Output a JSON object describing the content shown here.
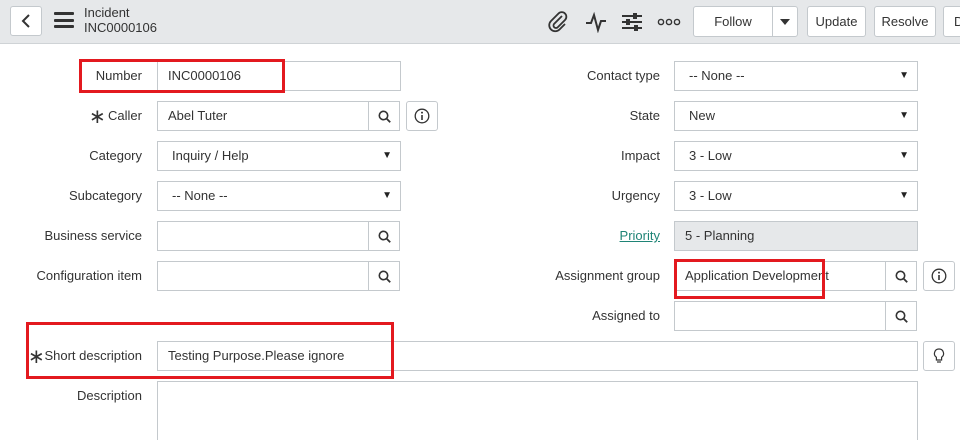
{
  "header": {
    "record_type": "Incident",
    "record_number": "INC0000106",
    "icons": [
      "back-icon",
      "menu-icon",
      "paperclip-icon",
      "activity-icon",
      "sliders-icon",
      "more-icon"
    ],
    "buttons": {
      "follow": "Follow",
      "update": "Update",
      "resolve": "Resolve",
      "delete_partial": "D"
    }
  },
  "form": {
    "number": {
      "label": "Number",
      "value": "INC0000106"
    },
    "caller": {
      "label": "Caller",
      "value": "Abel Tuter",
      "required": true
    },
    "category": {
      "label": "Category",
      "value": "Inquiry / Help"
    },
    "subcategory": {
      "label": "Subcategory",
      "value": "-- None --"
    },
    "business_service": {
      "label": "Business service",
      "value": ""
    },
    "configuration_item": {
      "label": "Configuration item",
      "value": ""
    },
    "contact_type": {
      "label": "Contact type",
      "value": "-- None --"
    },
    "state": {
      "label": "State",
      "value": "New"
    },
    "impact": {
      "label": "Impact",
      "value": "3 - Low"
    },
    "urgency": {
      "label": "Urgency",
      "value": "3 - Low"
    },
    "priority": {
      "label": "Priority",
      "value": "5 - Planning"
    },
    "assignment_group": {
      "label": "Assignment group",
      "value": "Application Development"
    },
    "assigned_to": {
      "label": "Assigned to",
      "value": ""
    },
    "short_description": {
      "label": "Short description",
      "value": "Testing Purpose.Please ignore",
      "required": true
    },
    "description": {
      "label": "Description",
      "value": ""
    }
  },
  "colors": {
    "highlight": "#e3191f",
    "link": "#1f8476",
    "header_bg": "#e6e8ea"
  }
}
